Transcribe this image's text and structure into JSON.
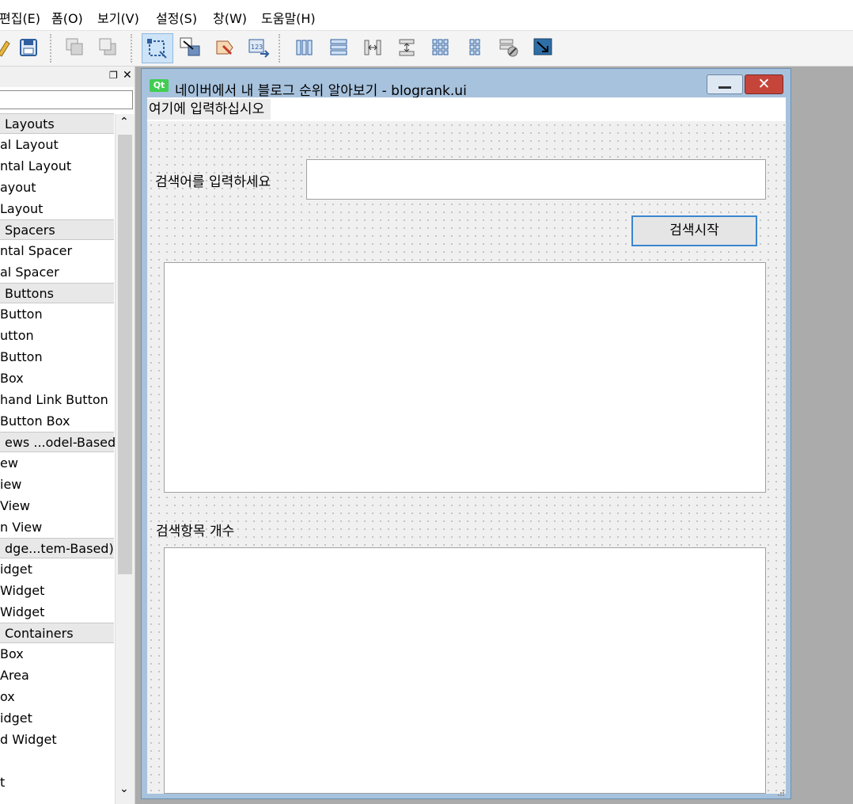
{
  "menubar": {
    "items": [
      "편집(E)",
      "폼(O)",
      "보기(V)",
      "설정(S)",
      "창(W)",
      "도움말(H)"
    ]
  },
  "toolbar": {
    "buttons": [
      "edit-icon",
      "save-icon",
      "send-to-back-icon",
      "bring-to-front-icon",
      "edit-widgets-icon",
      "edit-signals-slots-icon",
      "edit-buddies-icon",
      "edit-tab-order-icon",
      "lay-out-horizontally-icon",
      "lay-out-vertically-icon",
      "lay-out-horizontal-splitter-icon",
      "lay-out-vertical-splitter-icon",
      "lay-out-grid-icon",
      "lay-out-form-icon",
      "break-layout-icon",
      "adjust-size-icon"
    ]
  },
  "widget_box": {
    "header_icons": [
      "float-icon",
      "close-icon"
    ],
    "entries": [
      {
        "kind": "category",
        "label": "Layouts"
      },
      {
        "kind": "item",
        "label": "al Layout"
      },
      {
        "kind": "item",
        "label": "ntal Layout"
      },
      {
        "kind": "item",
        "label": "ayout"
      },
      {
        "kind": "item",
        "label": "Layout"
      },
      {
        "kind": "category",
        "label": "Spacers"
      },
      {
        "kind": "item",
        "label": "ntal Spacer"
      },
      {
        "kind": "item",
        "label": "al Spacer"
      },
      {
        "kind": "category",
        "label": "Buttons"
      },
      {
        "kind": "item",
        "label": "Button"
      },
      {
        "kind": "item",
        "label": "utton"
      },
      {
        "kind": "item",
        "label": "Button"
      },
      {
        "kind": "item",
        "label": "Box"
      },
      {
        "kind": "item",
        "label": "hand Link Button"
      },
      {
        "kind": "item",
        "label": "Button Box"
      },
      {
        "kind": "category",
        "label": "ews ...odel-Based)"
      },
      {
        "kind": "item",
        "label": "ew"
      },
      {
        "kind": "item",
        "label": "iew"
      },
      {
        "kind": "item",
        "label": "View"
      },
      {
        "kind": "item",
        "label": "n View"
      },
      {
        "kind": "category",
        "label": "dge...tem-Based)"
      },
      {
        "kind": "item",
        "label": "idget"
      },
      {
        "kind": "item",
        "label": "Widget"
      },
      {
        "kind": "item",
        "label": "Widget"
      },
      {
        "kind": "category",
        "label": "Containers"
      },
      {
        "kind": "item",
        "label": "Box"
      },
      {
        "kind": "item",
        "label": "Area"
      },
      {
        "kind": "item",
        "label": "ox"
      },
      {
        "kind": "item",
        "label": "idget"
      },
      {
        "kind": "item",
        "label": "d Widget"
      },
      {
        "kind": "item",
        "label": ""
      },
      {
        "kind": "item",
        "label": "t"
      }
    ]
  },
  "form_window": {
    "title": "네이버에서 내 블로그 순위 알아보기 - blogrank.ui",
    "qt_badge": "Qt",
    "menu_placeholder": "여기에 입력하십시오",
    "search_label": "검색어를 입력하세요",
    "search_value": "",
    "search_button": "검색시작",
    "count_label": "검색항목 개수"
  },
  "colors": {
    "title_bar": "#a7c2dd",
    "close_button": "#c6453a",
    "button_focus_border": "#3a86d0",
    "qt_green": "#41cd52"
  }
}
